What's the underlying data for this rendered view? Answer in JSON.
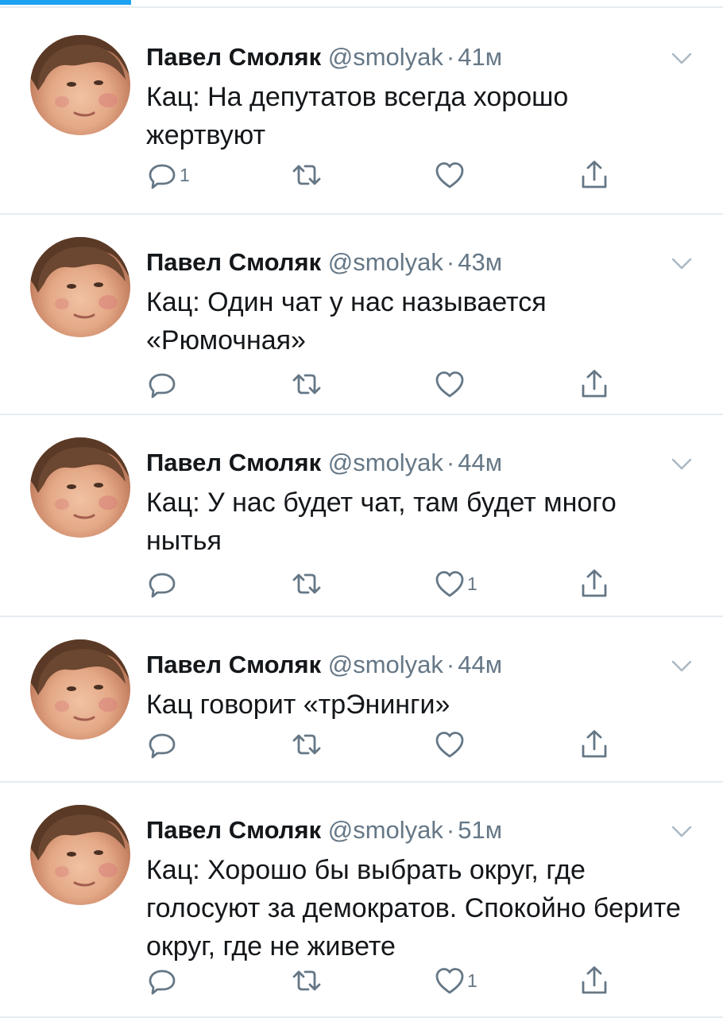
{
  "accent_color": "#1da1f2",
  "icons": {
    "reply": "reply-icon",
    "retweet": "retweet-icon",
    "like": "heart-icon",
    "share": "share-icon",
    "caret": "chevron-down-icon"
  },
  "tweets": [
    {
      "name": "Павел Смоляк",
      "handle": "@smolyak",
      "separator": "·",
      "time": "41м",
      "text": "Кац: На депутатов всегда хорошо жертвуют",
      "reply_count": "1",
      "retweet_count": "",
      "like_count": ""
    },
    {
      "name": "Павел Смоляк",
      "handle": "@smolyak",
      "separator": "·",
      "time": "43м",
      "text": "Кац: Один чат у нас называется «Рюмочная»",
      "reply_count": "",
      "retweet_count": "",
      "like_count": ""
    },
    {
      "name": "Павел Смоляк",
      "handle": "@smolyak",
      "separator": "·",
      "time": "44м",
      "text": "Кац: У нас будет чат, там будет много нытья",
      "reply_count": "",
      "retweet_count": "",
      "like_count": "1"
    },
    {
      "name": "Павел Смоляк",
      "handle": "@smolyak",
      "separator": "·",
      "time": "44м",
      "text": "Кац говорит «трЭнинги»",
      "reply_count": "",
      "retweet_count": "",
      "like_count": ""
    },
    {
      "name": "Павел Смоляк",
      "handle": "@smolyak",
      "separator": "·",
      "time": "51м",
      "text": "Кац: Хорошо бы выбрать округ, где голосуют за демократов. Спокойно берите округ, где не живете",
      "reply_count": "",
      "retweet_count": "",
      "like_count": "1"
    }
  ]
}
